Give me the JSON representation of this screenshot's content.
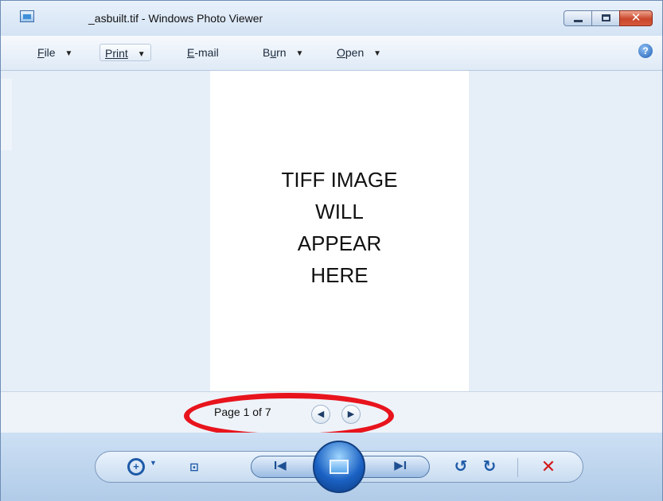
{
  "window": {
    "title": "_asbuilt.tif - Windows Photo Viewer",
    "icon": "photo-viewer-app-icon",
    "controls": {
      "minimize": "minimize-icon",
      "maximize": "maximize-icon",
      "close_glyph": "✕"
    }
  },
  "menubar": {
    "items": [
      {
        "label": "File",
        "mnemonic_first": "F",
        "rest": "ile",
        "has_dropdown": true
      },
      {
        "label": "Print",
        "mnemonic_first": "P",
        "rest": "rint",
        "has_dropdown": true
      },
      {
        "label": "E-mail",
        "mnemonic_first": "E",
        "rest": "-mail",
        "has_dropdown": false
      },
      {
        "label": "Burn",
        "pre": "B",
        "mnemonic": "u",
        "post": "rn",
        "has_dropdown": true
      },
      {
        "label": "Open",
        "mnemonic_first": "O",
        "rest": "pen",
        "has_dropdown": true
      }
    ],
    "help_glyph": "?"
  },
  "document": {
    "lines": [
      "TIFF IMAGE",
      "WILL",
      "APPEAR",
      "HERE"
    ]
  },
  "pager": {
    "label": "Page 1 of 7",
    "prev_glyph": "◀",
    "next_glyph": "▶"
  },
  "toolbar": {
    "zoom_glyph": "+",
    "zoom_arrow": "▼",
    "fit_glyph": "⊡",
    "prev_glyph": "I◀",
    "next_glyph": "▶I",
    "rotate_ccw_glyph": "↺",
    "rotate_cw_glyph": "↻",
    "delete_glyph": "✕"
  },
  "colors": {
    "annotation_ellipse": "#e8141d",
    "accent_blue": "#1e5aa8",
    "delete_red": "#d31a1a"
  }
}
